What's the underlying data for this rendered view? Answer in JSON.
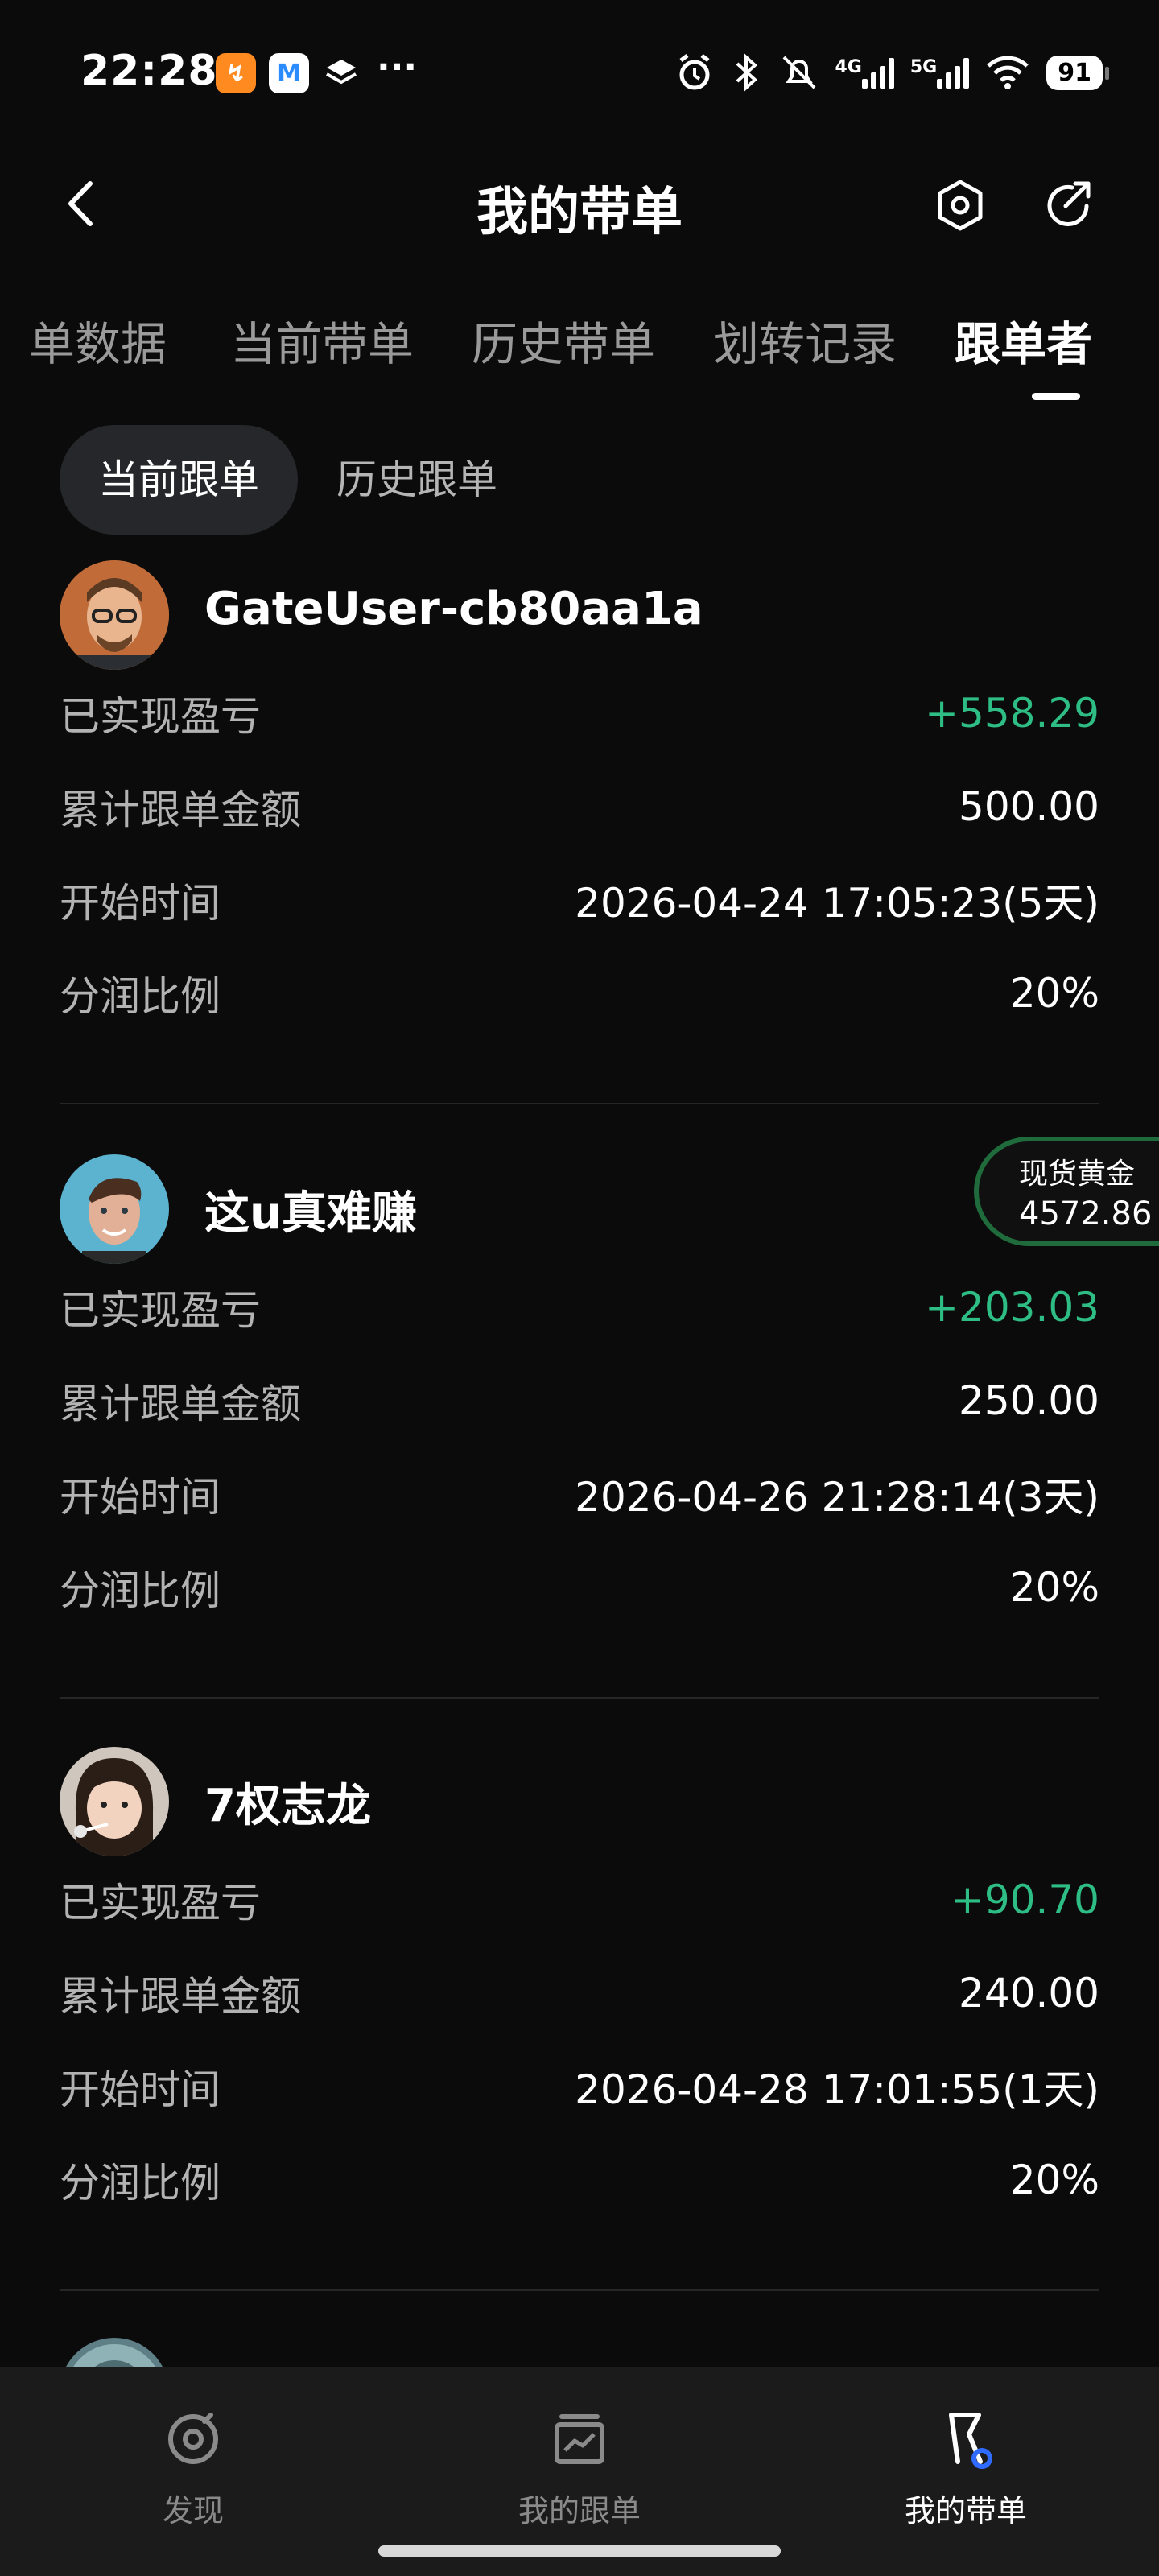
{
  "status_bar": {
    "time": "22:28",
    "app_badges": [
      {
        "name": "orange-app-icon",
        "glyph": "↯",
        "color": "#ff8a1f"
      },
      {
        "name": "m-app-icon",
        "glyph": "M",
        "color": "#2a8cff"
      }
    ],
    "more": "···",
    "net1": "4G",
    "net2": "5G",
    "battery": "91"
  },
  "header": {
    "title": "我的带单"
  },
  "tabs": [
    {
      "label": "单数据",
      "active": false
    },
    {
      "label": "当前带单",
      "active": false
    },
    {
      "label": "历史带单",
      "active": false
    },
    {
      "label": "划转记录",
      "active": false
    },
    {
      "label": "跟单者",
      "active": true
    }
  ],
  "subtabs": [
    {
      "label": "当前跟单",
      "active": true
    },
    {
      "label": "历史跟单",
      "active": false
    }
  ],
  "labels": {
    "pnl": "已实现盈亏",
    "amount": "累计跟单金额",
    "start": "开始时间",
    "share": "分润比例"
  },
  "followers": [
    {
      "name": "GateUser-cb80aa1a",
      "pnl": "+558.29",
      "amount": "500.00",
      "start": "2026-04-24 17:05:23(5天)",
      "share": "20%"
    },
    {
      "name": "这u真难赚",
      "pnl": "+203.03",
      "amount": "250.00",
      "start": "2026-04-26 21:28:14(3天)",
      "share": "20%"
    },
    {
      "name": "7权志龙",
      "pnl": "+90.70",
      "amount": "240.00",
      "start": "2026-04-28 17:01:55(1天)",
      "share": "20%"
    }
  ],
  "gold_widget": {
    "label": "现货黄金",
    "price": "4572.86"
  },
  "bottom_nav": [
    {
      "label": "发现",
      "icon": "discover-icon",
      "active": false
    },
    {
      "label": "我的跟单",
      "icon": "chart-icon",
      "active": false
    },
    {
      "label": "我的带单",
      "icon": "flag-icon",
      "active": true
    }
  ],
  "colors": {
    "background": "#0b0b0b",
    "positive": "#2ebd85",
    "accent_blue": "#2f6bff"
  }
}
